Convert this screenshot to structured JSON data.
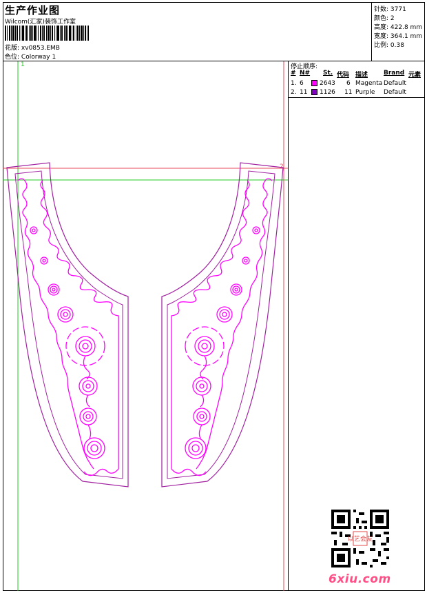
{
  "header": {
    "title": "生产作业图",
    "studio": "Wilcom(汇家)装饰工作室",
    "design_label": "花版:",
    "design_value": "xv0853.EMB",
    "colorway_label": "色位:",
    "colorway_value": "Colorway 1"
  },
  "stats": [
    {
      "label": "针数:",
      "value": "3771"
    },
    {
      "label": "颜色:",
      "value": "2"
    },
    {
      "label": "高度:",
      "value": "422.8 mm"
    },
    {
      "label": "宽度:",
      "value": "364.1 mm"
    },
    {
      "label": "比例:",
      "value": "0.38"
    }
  ],
  "stop_sequence": {
    "title": "停止顺序:",
    "headers": [
      "#",
      "N#",
      "St.",
      "代码",
      "描述",
      "Brand",
      "元素"
    ],
    "rows": [
      {
        "index": "1.",
        "needle": "6",
        "stitches": "2643",
        "code": "6",
        "description": "Magenta",
        "brand": "Default",
        "color": "#ff00ff"
      },
      {
        "index": "2.",
        "needle": "11",
        "stitches": "1126",
        "code": "11",
        "description": "Purple",
        "brand": "Default",
        "color": "#8000c0"
      }
    ]
  },
  "guides": {
    "marker_1": "1",
    "marker_2": "2",
    "guide_green": "#22cc22",
    "guide_red": "#e8485a"
  },
  "embroidery_colors": {
    "outline": "#a020a0",
    "inner": "#ff00ff"
  },
  "watermark": "6xiu.com",
  "qr_stamp": "以艺会友"
}
